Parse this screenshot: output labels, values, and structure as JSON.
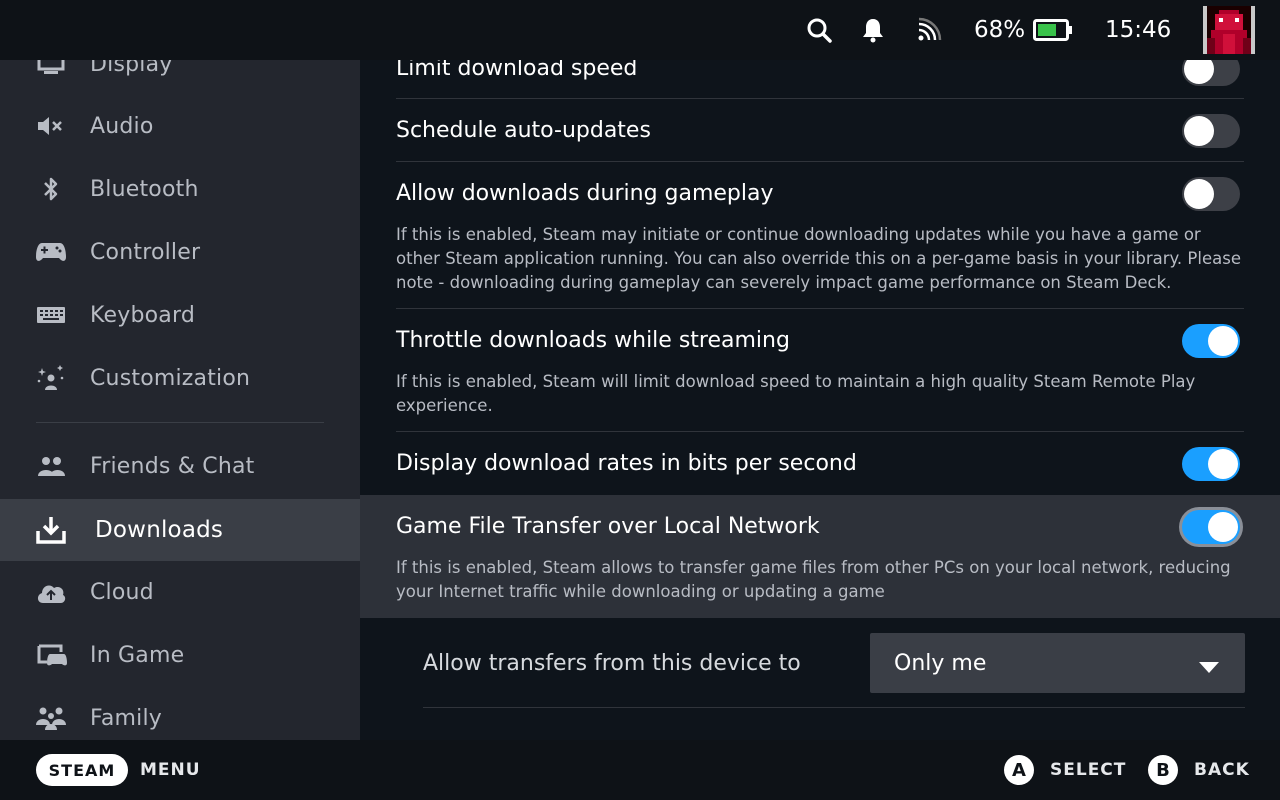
{
  "status_bar": {
    "battery_percent": "68%",
    "battery_level": 0.68,
    "time": "15:46",
    "icons": [
      "search-icon",
      "bell-icon",
      "wifi-icon",
      "battery-icon",
      "avatar"
    ]
  },
  "sidebar": {
    "items": [
      {
        "label": "Display",
        "icon": "monitor-icon"
      },
      {
        "label": "Audio",
        "icon": "speaker-muted-icon"
      },
      {
        "label": "Bluetooth",
        "icon": "bluetooth-icon"
      },
      {
        "label": "Controller",
        "icon": "gamepad-icon"
      },
      {
        "label": "Keyboard",
        "icon": "keyboard-icon"
      },
      {
        "label": "Customization",
        "icon": "sparkle-person-icon"
      },
      {
        "label": "Friends & Chat",
        "icon": "friends-icon"
      },
      {
        "label": "Downloads",
        "icon": "download-icon",
        "active": true
      },
      {
        "label": "Cloud",
        "icon": "cloud-icon"
      },
      {
        "label": "In Game",
        "icon": "in-game-icon"
      },
      {
        "label": "Family",
        "icon": "family-icon"
      }
    ]
  },
  "settings": {
    "limit_speed": {
      "title": "Limit download speed",
      "enabled": false
    },
    "schedule": {
      "title": "Schedule auto-updates",
      "enabled": false
    },
    "during_gameplay": {
      "title": "Allow downloads during gameplay",
      "enabled": false,
      "description": "If this is enabled, Steam may initiate or continue downloading updates while you have a game or other Steam application running. You can also override this on a per-game basis in your library. Please note - downloading during gameplay can severely impact game performance on Steam Deck."
    },
    "throttle": {
      "title": "Throttle downloads while streaming",
      "enabled": true,
      "description": "If this is enabled, Steam will limit download speed to maintain a high quality Steam Remote Play experience."
    },
    "bits": {
      "title": "Display download rates in bits per second",
      "enabled": true
    },
    "local_transfer": {
      "title": "Game File Transfer over Local Network",
      "enabled": true,
      "description": "If this is enabled, Steam allows to transfer game files from other PCs on your local network, reducing your Internet traffic while downloading or updating a game"
    },
    "transfer_to": {
      "label": "Allow transfers from this device to",
      "value": "Only me"
    }
  },
  "bottom_bar": {
    "steam": "STEAM",
    "menu": "MENU",
    "a": "A",
    "select": "SELECT",
    "b": "B",
    "back": "BACK"
  },
  "colors": {
    "accent": "#1a9fff",
    "sidebar_bg": "#23262e",
    "content_bg": "#0e141b",
    "highlight_bg": "#2d3139"
  }
}
